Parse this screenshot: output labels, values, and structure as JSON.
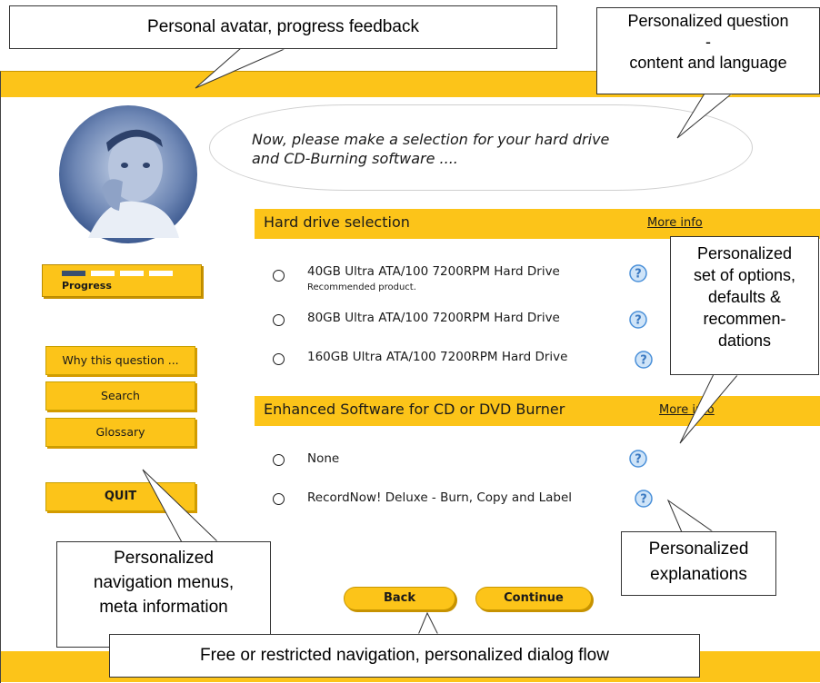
{
  "annotations": {
    "avatar_progress": "Personal avatar, progress feedback",
    "question_line1": "Personalized question",
    "question_line2": "-",
    "question_line3": "content and language",
    "options_line1": "Personalized",
    "options_line2": "set of options,",
    "options_line3": "defaults &",
    "options_line4": "recommen-",
    "options_line5": "dations",
    "nav_line1": "Personalized",
    "nav_line2": "navigation menus,",
    "nav_line3": "meta information",
    "expl_line1": "Personalized",
    "expl_line2": "explanations",
    "flow": "Free or restricted navigation, personalized dialog flow"
  },
  "app": {
    "question_line1": "Now, please make a selection for your hard drive",
    "question_line2": "and CD-Burning software ....",
    "progress": {
      "label": "Progress",
      "segments_total": 4,
      "segments_done": 1
    },
    "sidebar": {
      "why_label": "Why this question ...",
      "search_label": "Search",
      "glossary_label": "Glossary",
      "quit_label": "QUIT"
    },
    "hard_drive": {
      "title": "Hard drive selection",
      "more_info": "More info",
      "options": [
        {
          "label": "40GB Ultra ATA/100 7200RPM Hard Drive",
          "note": "Recommended product."
        },
        {
          "label": "80GB Ultra ATA/100 7200RPM Hard Drive",
          "note": ""
        },
        {
          "label": "160GB Ultra ATA/100 7200RPM Hard Drive",
          "note": ""
        }
      ]
    },
    "software": {
      "title": "Enhanced Software for CD or DVD Burner",
      "more_info": "More info",
      "options": [
        {
          "label": "None"
        },
        {
          "label": "RecordNow! Deluxe - Burn, Copy and Label"
        }
      ]
    },
    "nav": {
      "back_label": "Back",
      "continue_label": "Continue"
    },
    "colors": {
      "accent": "#fcc419",
      "help_icon": "#5aa0e0"
    }
  }
}
